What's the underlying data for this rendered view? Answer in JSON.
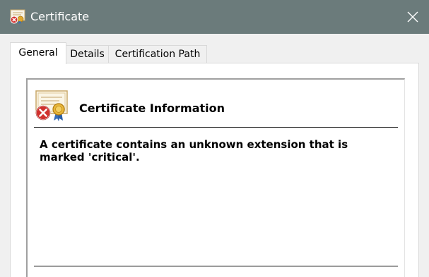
{
  "window": {
    "title": "Certificate"
  },
  "tabs": [
    {
      "label": "General",
      "active": true
    },
    {
      "label": "Details",
      "active": false
    },
    {
      "label": "Certification Path",
      "active": false
    }
  ],
  "general": {
    "header": "Certificate Information",
    "message": "A certificate contains an unknown extension that is marked 'critical'."
  },
  "icons": {
    "title": "certificate-error-icon",
    "close": "close-icon",
    "info": "certificate-error-icon"
  },
  "colors": {
    "titlebar": "#6b7b7b",
    "error_red": "#d0312d",
    "seal_gold": "#e0a82e"
  }
}
